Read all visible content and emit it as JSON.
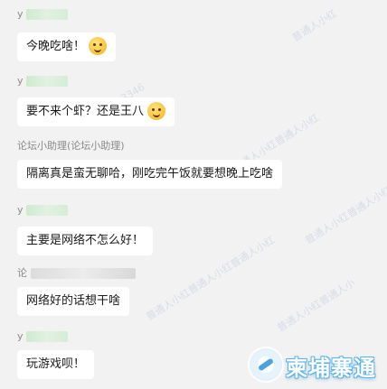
{
  "messages": [
    {
      "sender_visible": "y",
      "text": "今晚吃啥！",
      "emoji": "yum-face"
    },
    {
      "sender_visible": "y",
      "text": "要不来个虾？还是王八",
      "emoji": "laugh-cry-face"
    },
    {
      "sender_visible": "论坛小助理(论坛小助理)",
      "text": "隔离真是蛮无聊哈，刚吃完午饭就要想晚上吃啥",
      "emoji": ""
    },
    {
      "sender_visible": "y",
      "text": "主要是网络不怎么好！",
      "emoji": ""
    },
    {
      "sender_visible": "论",
      "text": "网络好的话想干啥",
      "emoji": ""
    },
    {
      "sender_visible": "y",
      "text": "玩游戏呗！",
      "emoji": ""
    }
  ],
  "watermarks": [
    "普通人小红",
    "普通人小红普通人小红",
    "普通人小红普通人小红普通人小红",
    "普通人小红普通人小",
    "普通人小红普通人小红",
    "313346"
  ],
  "logo": {
    "text": "柬埔寨通",
    "accent_color": "#4aa3df"
  },
  "colors": {
    "background": "#f2f2f2",
    "bubble": "#ffffff",
    "sender": "#8a8a8a"
  }
}
